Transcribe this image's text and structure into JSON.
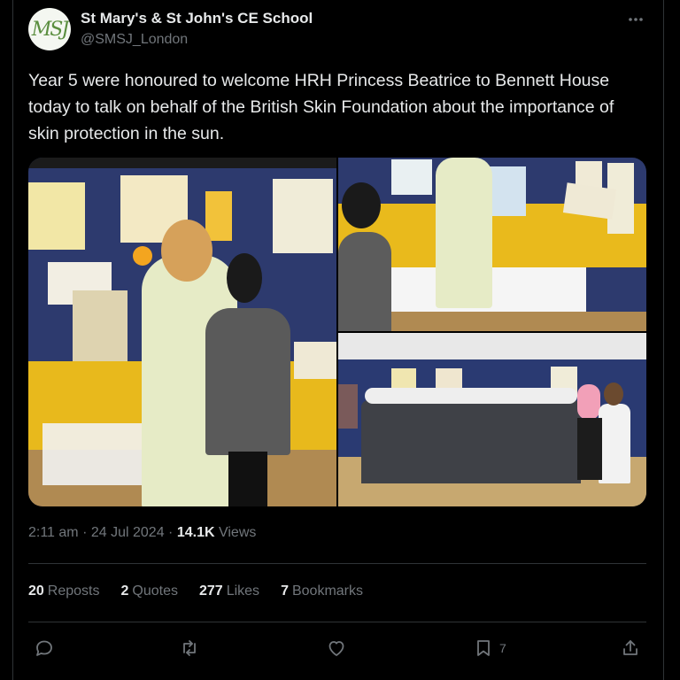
{
  "author": {
    "avatar_text": "MSJ",
    "name": "St Mary's & St John's CE School",
    "handle": "@SMSJ_London"
  },
  "tweet": {
    "text": "Year 5 were honoured to welcome HRH Princess Beatrice to Bennett House today to talk on behalf of the British Skin Foundation about the importance of skin protection in the sun."
  },
  "meta": {
    "time": "2:11 am",
    "separator": "·",
    "date": "24 Jul 2024",
    "views_count": "14.1K",
    "views_label": "Views"
  },
  "stats": {
    "reposts_count": "20",
    "reposts_label": "Reposts",
    "quotes_count": "2",
    "quotes_label": "Quotes",
    "likes_count": "277",
    "likes_label": "Likes",
    "bookmarks_count": "7",
    "bookmarks_label": "Bookmarks"
  },
  "actions": {
    "bookmark_count": "7"
  },
  "icons": {
    "more": "more-icon",
    "reply": "reply-icon",
    "repost": "repost-icon",
    "like": "heart-icon",
    "bookmark": "bookmark-icon",
    "share": "share-icon"
  },
  "colors": {
    "background": "#000000",
    "text": "#e7e9ea",
    "muted": "#71767b",
    "border": "#2f3336"
  }
}
